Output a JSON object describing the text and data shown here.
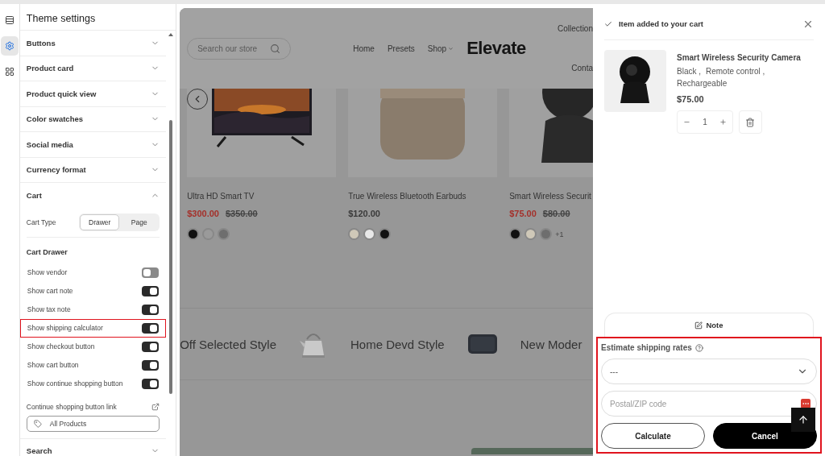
{
  "rail_items": [
    {
      "selected": false
    },
    {
      "selected": true
    },
    {
      "selected": false
    }
  ],
  "settings": {
    "title": "Theme settings",
    "sections": [
      {
        "label": "Buttons",
        "expanded": false
      },
      {
        "label": "Product card",
        "expanded": false
      },
      {
        "label": "Product quick view",
        "expanded": false
      },
      {
        "label": "Color swatches",
        "expanded": false
      },
      {
        "label": "Social media",
        "expanded": false
      },
      {
        "label": "Currency format",
        "expanded": false
      },
      {
        "label": "Cart",
        "expanded": true
      },
      {
        "label": "Search",
        "expanded": false
      }
    ],
    "cart_body": {
      "type_label": "Cart Type",
      "type_options": [
        {
          "label": "Drawer",
          "selected": true
        },
        {
          "label": "Page",
          "selected": false
        }
      ],
      "drawer_heading": "Cart Drawer",
      "toggles": [
        {
          "label": "Show vendor",
          "on": false,
          "highlighted": false
        },
        {
          "label": "Show cart note",
          "on": true,
          "highlighted": false
        },
        {
          "label": "Show tax note",
          "on": true,
          "highlighted": false
        },
        {
          "label": "Show shipping calculator",
          "on": true,
          "highlighted": true
        },
        {
          "label": "Show checkout button",
          "on": true,
          "highlighted": false
        },
        {
          "label": "Show cart button",
          "on": true,
          "highlighted": false
        },
        {
          "label": "Show continue shopping button",
          "on": true,
          "highlighted": false
        }
      ],
      "link_label": "Continue shopping button link",
      "link_value": "All Products"
    }
  },
  "preview": {
    "search": {
      "placeholder": "Search our store"
    },
    "nav": [
      {
        "label": "Home",
        "kind": "link"
      },
      {
        "label": "Presets",
        "kind": "link"
      },
      {
        "label": "Shop",
        "kind": "dropdown"
      }
    ],
    "logo": "Elevate",
    "nav_right_top": "Collection",
    "nav_right_bottom": "Conta",
    "products": [
      {
        "name": "Ultra HD Smart TV",
        "price": "$300.00",
        "compare_price": "$350.00",
        "sale": true,
        "kind": "tv",
        "swatches": [
          {
            "color": "#111111"
          },
          {
            "color": "#9a9a9a"
          },
          {
            "color": "#6e6e6e"
          }
        ]
      },
      {
        "name": "True Wireless Bluetooth Earbuds",
        "price": "$120.00",
        "sale": false,
        "kind": "earbuds",
        "swatches": [
          {
            "color": "#cfc8b8"
          },
          {
            "color": "#e8e8e8"
          },
          {
            "color": "#111111"
          }
        ]
      },
      {
        "name": "Smart Wireless Securit",
        "price": "$75.00",
        "compare_price": "$80.00",
        "sale": true,
        "kind": "camera",
        "swatches": [
          {
            "color": "#111111"
          },
          {
            "color": "#cfc8b8"
          },
          {
            "color": "#6e6e6e"
          }
        ],
        "more": "+1"
      }
    ],
    "marquee": [
      {
        "label": "Off Selected Style",
        "kind": "kettle"
      },
      {
        "label": "Home Devd Style",
        "kind": "speaker"
      },
      {
        "label": "New Moder",
        "kind": "none"
      }
    ]
  },
  "drawer": {
    "header": "Item added to your cart",
    "item": {
      "name": "Smart Wireless Security Camera",
      "variants": [
        "Black ,",
        "Remote control ,",
        "Rechargeable"
      ],
      "price": "$75.00",
      "quantity": "1"
    },
    "note_button": "Note",
    "shipping": {
      "highlighted": true,
      "title": "Estimate shipping rates",
      "country": {
        "value": "---"
      },
      "zip": {
        "placeholder": "Postal/ZIP code"
      },
      "buttons": [
        {
          "label": "Calculate",
          "kind": "secondary"
        },
        {
          "label": "Cancel",
          "kind": "primary"
        }
      ]
    }
  }
}
